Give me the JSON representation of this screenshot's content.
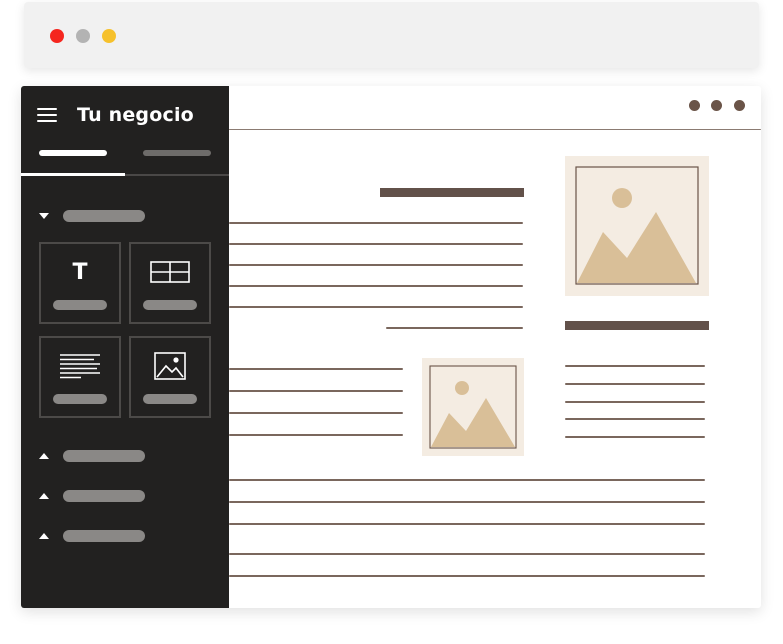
{
  "window_controls": {
    "colors": {
      "red": "#f5261f",
      "gray": "#b3b3b3",
      "yellow": "#f6c12c"
    }
  },
  "sidebar": {
    "brand": "Tu negocio",
    "tabs": [
      {
        "active": true
      },
      {
        "active": false
      }
    ],
    "sections": [
      {
        "expanded": true
      },
      {
        "expanded": false
      },
      {
        "expanded": false
      },
      {
        "expanded": false
      }
    ],
    "tiles": [
      {
        "icon": "text-icon",
        "glyph": "T"
      },
      {
        "icon": "table-icon"
      },
      {
        "icon": "paragraph-icon"
      },
      {
        "icon": "image-icon"
      }
    ]
  },
  "content": {
    "menu_icon": "more-dots-icon"
  },
  "colors": {
    "sidebar_bg": "#222120",
    "accent_brown": "#62514a",
    "image_bg": "#f4ece2",
    "image_fill": "#d9bf98"
  }
}
